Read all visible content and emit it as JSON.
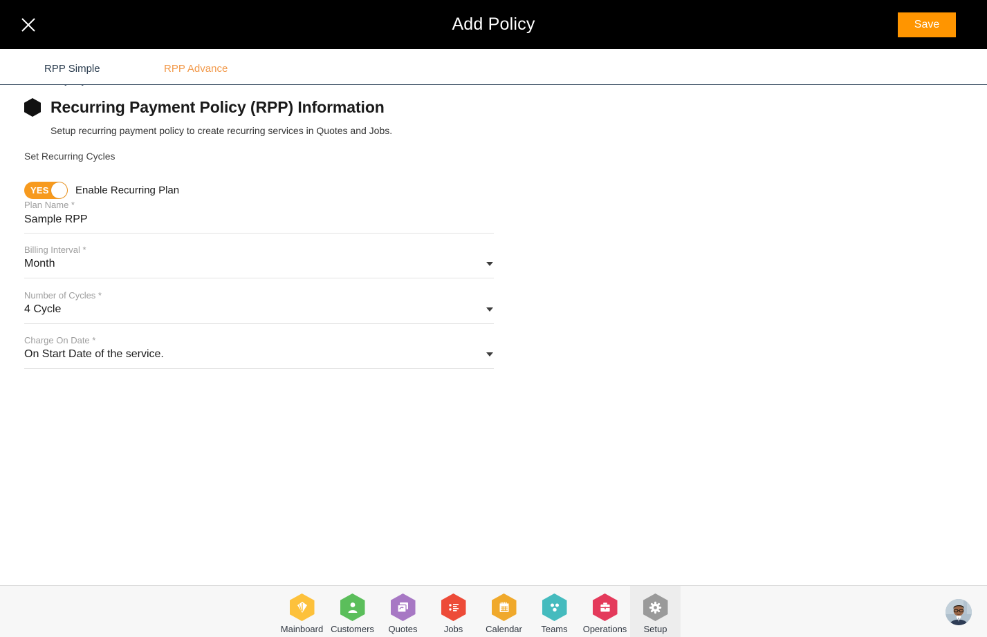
{
  "topbar": {
    "close_icon": "close-icon",
    "title": "Add Policy",
    "save_label": "Save",
    "save_color": "#FF9500"
  },
  "tabs": [
    {
      "label": "RPP Simple",
      "active": true,
      "color": "#2c3e50"
    },
    {
      "label": "RPP Advance",
      "active": false,
      "color": "#F2994A"
    }
  ],
  "section": {
    "icon": "hexagon-icon",
    "title": "Recurring Payment Policy (RPP) Information",
    "subtitle": "Setup recurring payment policy to create recurring services in Quotes and Jobs.",
    "group_label": "Set Recurring Cycles"
  },
  "toggle": {
    "state_text": "YES",
    "label": "Enable Recurring Plan",
    "on": true,
    "color": "#F79A1E"
  },
  "fields": [
    {
      "label": "Plan Name *",
      "value": "Sample RPP",
      "placeholder": "Plan Name",
      "type": "text",
      "name": "plan-name"
    },
    {
      "label": "Billing Interval *",
      "value": "Month",
      "placeholder": "Billing Interval",
      "type": "select",
      "name": "billing-interval"
    },
    {
      "label": "Number of Cycles *",
      "value": "4 Cycle",
      "placeholder": "Number of Cycles",
      "type": "select",
      "name": "number-of-cycles"
    },
    {
      "label": "Charge On Date *",
      "value": "On Start Date of the service.",
      "placeholder": "Charge On Date",
      "type": "select",
      "name": "charge-on-date"
    }
  ],
  "footer": {
    "nav": [
      {
        "label": "Mainboard",
        "icon": "fan-icon",
        "color": "#FDC13B",
        "active": false
      },
      {
        "label": "Customers",
        "icon": "person-icon",
        "color": "#5BBE5B",
        "active": false
      },
      {
        "label": "Quotes",
        "icon": "documents-icon",
        "color": "#A778C4",
        "active": false
      },
      {
        "label": "Jobs",
        "icon": "list-icon",
        "color": "#ED4B38",
        "active": false
      },
      {
        "label": "Calendar",
        "icon": "calendar-icon",
        "color": "#F0A92B",
        "active": false
      },
      {
        "label": "Teams",
        "icon": "team-icon",
        "color": "#45BBBE",
        "active": false
      },
      {
        "label": "Operations",
        "icon": "briefcase-icon",
        "color": "#E43A5B",
        "active": false
      },
      {
        "label": "Setup",
        "icon": "gear-icon",
        "color": "#9A9A9A",
        "active": true
      }
    ],
    "avatar": "user-avatar"
  }
}
